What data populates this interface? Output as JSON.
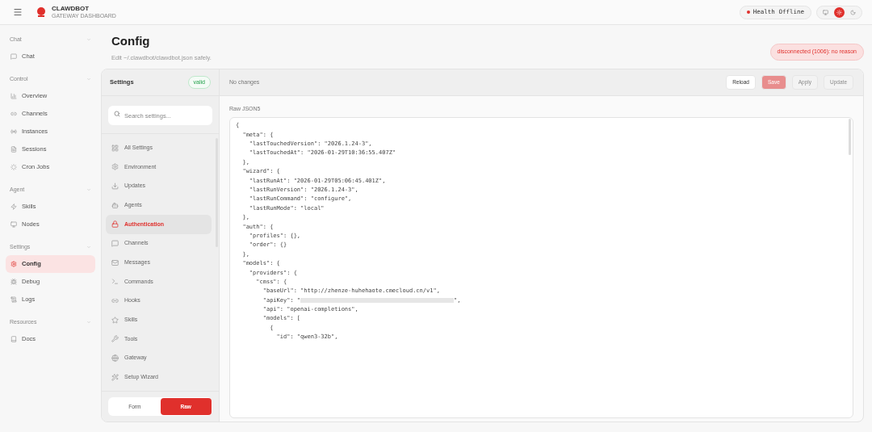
{
  "header": {
    "brand": "CLAWDBOT",
    "subtitle": "GATEWAY DASHBOARD",
    "health_label": "Health",
    "health_status": "Offline",
    "online": false,
    "theme_modes": [
      {
        "selected": false
      },
      {
        "selected": true
      },
      {
        "selected": false
      }
    ]
  },
  "sidebar": {
    "groups": [
      {
        "title": "Chat",
        "items": [
          {
            "label": "Chat",
            "selected": false
          }
        ]
      },
      {
        "title": "Control",
        "items": [
          {
            "label": "Overview",
            "selected": false
          },
          {
            "label": "Channels",
            "selected": false
          },
          {
            "label": "Instances",
            "selected": false
          },
          {
            "label": "Sessions",
            "selected": false
          },
          {
            "label": "Cron Jobs",
            "selected": false
          }
        ]
      },
      {
        "title": "Agent",
        "items": [
          {
            "label": "Skills",
            "selected": false
          },
          {
            "label": "Nodes",
            "selected": false
          }
        ]
      },
      {
        "title": "Settings",
        "items": [
          {
            "label": "Config",
            "selected": true
          },
          {
            "label": "Debug",
            "selected": false
          },
          {
            "label": "Logs",
            "selected": false
          }
        ]
      },
      {
        "title": "Resources",
        "items": [
          {
            "label": "Docs",
            "selected": false
          }
        ]
      }
    ]
  },
  "page": {
    "title": "Config",
    "subtitle": "Edit ~/.clawdbot/clawdbot.json safely.",
    "connection_error": "disconnected (1006): no reason"
  },
  "settings_panel": {
    "title": "Settings",
    "status": "valid",
    "search": {
      "placeholder": "Search settings..."
    },
    "sections": [
      {
        "label": "All Settings",
        "selected": false
      },
      {
        "label": "Environment",
        "selected": false
      },
      {
        "label": "Updates",
        "selected": false
      },
      {
        "label": "Agents",
        "selected": false
      },
      {
        "label": "Authentication",
        "selected": true
      },
      {
        "label": "Channels",
        "selected": false
      },
      {
        "label": "Messages",
        "selected": false
      },
      {
        "label": "Commands",
        "selected": false
      },
      {
        "label": "Hooks",
        "selected": false
      },
      {
        "label": "Skills",
        "selected": false
      },
      {
        "label": "Tools",
        "selected": false
      },
      {
        "label": "Gateway",
        "selected": false
      },
      {
        "label": "Setup Wizard",
        "selected": false
      }
    ],
    "modes": [
      {
        "label": "Form",
        "selected": false
      },
      {
        "label": "Raw",
        "selected": true
      }
    ]
  },
  "editor": {
    "status": "No changes",
    "buttons": [
      {
        "label": "Reload",
        "kind": "default",
        "disabled": false
      },
      {
        "label": "Save",
        "kind": "primary",
        "disabled": true
      },
      {
        "label": "Apply",
        "kind": "default",
        "disabled": true
      },
      {
        "label": "Update",
        "kind": "default",
        "disabled": true
      }
    ],
    "field_label": "Raw JSON5",
    "lines": [
      {
        "kind": "text",
        "text": "{"
      },
      {
        "kind": "text",
        "text": "  \"meta\": {"
      },
      {
        "kind": "text",
        "text": "    \"lastTouchedVersion\": \"2026.1.24-3\","
      },
      {
        "kind": "text",
        "text": "    \"lastTouchedAt\": \"2026-01-29T10:36:55.407Z\""
      },
      {
        "kind": "text",
        "text": "  },"
      },
      {
        "kind": "text",
        "text": "  \"wizard\": {"
      },
      {
        "kind": "text",
        "text": "    \"lastRunAt\": \"2026-01-29T05:06:45.401Z\","
      },
      {
        "kind": "text",
        "text": "    \"lastRunVersion\": \"2026.1.24-3\","
      },
      {
        "kind": "text",
        "text": "    \"lastRunCommand\": \"configure\","
      },
      {
        "kind": "text",
        "text": "    \"lastRunMode\": \"local\""
      },
      {
        "kind": "text",
        "text": "  },"
      },
      {
        "kind": "text",
        "text": "  \"auth\": {"
      },
      {
        "kind": "text",
        "text": "    \"profiles\": {},"
      },
      {
        "kind": "text",
        "text": "    \"order\": {}"
      },
      {
        "kind": "text",
        "text": "  },"
      },
      {
        "kind": "text",
        "text": "  \"models\": {"
      },
      {
        "kind": "text",
        "text": "    \"providers\": {"
      },
      {
        "kind": "text",
        "text": "      \"cmss\": {"
      },
      {
        "kind": "text",
        "text": "        \"baseUrl\": \"http://zhenze-huhehaote.cmecloud.cn/v1\","
      },
      {
        "kind": "redacted",
        "text": "        \"apiKey\": \"",
        "suffix": "\","
      },
      {
        "kind": "text",
        "text": "        \"api\": \"openai-completions\","
      },
      {
        "kind": "text",
        "text": "        \"models\": ["
      },
      {
        "kind": "text",
        "text": "          {"
      },
      {
        "kind": "text",
        "text": "            \"id\": \"qwen3-32b\","
      }
    ]
  }
}
